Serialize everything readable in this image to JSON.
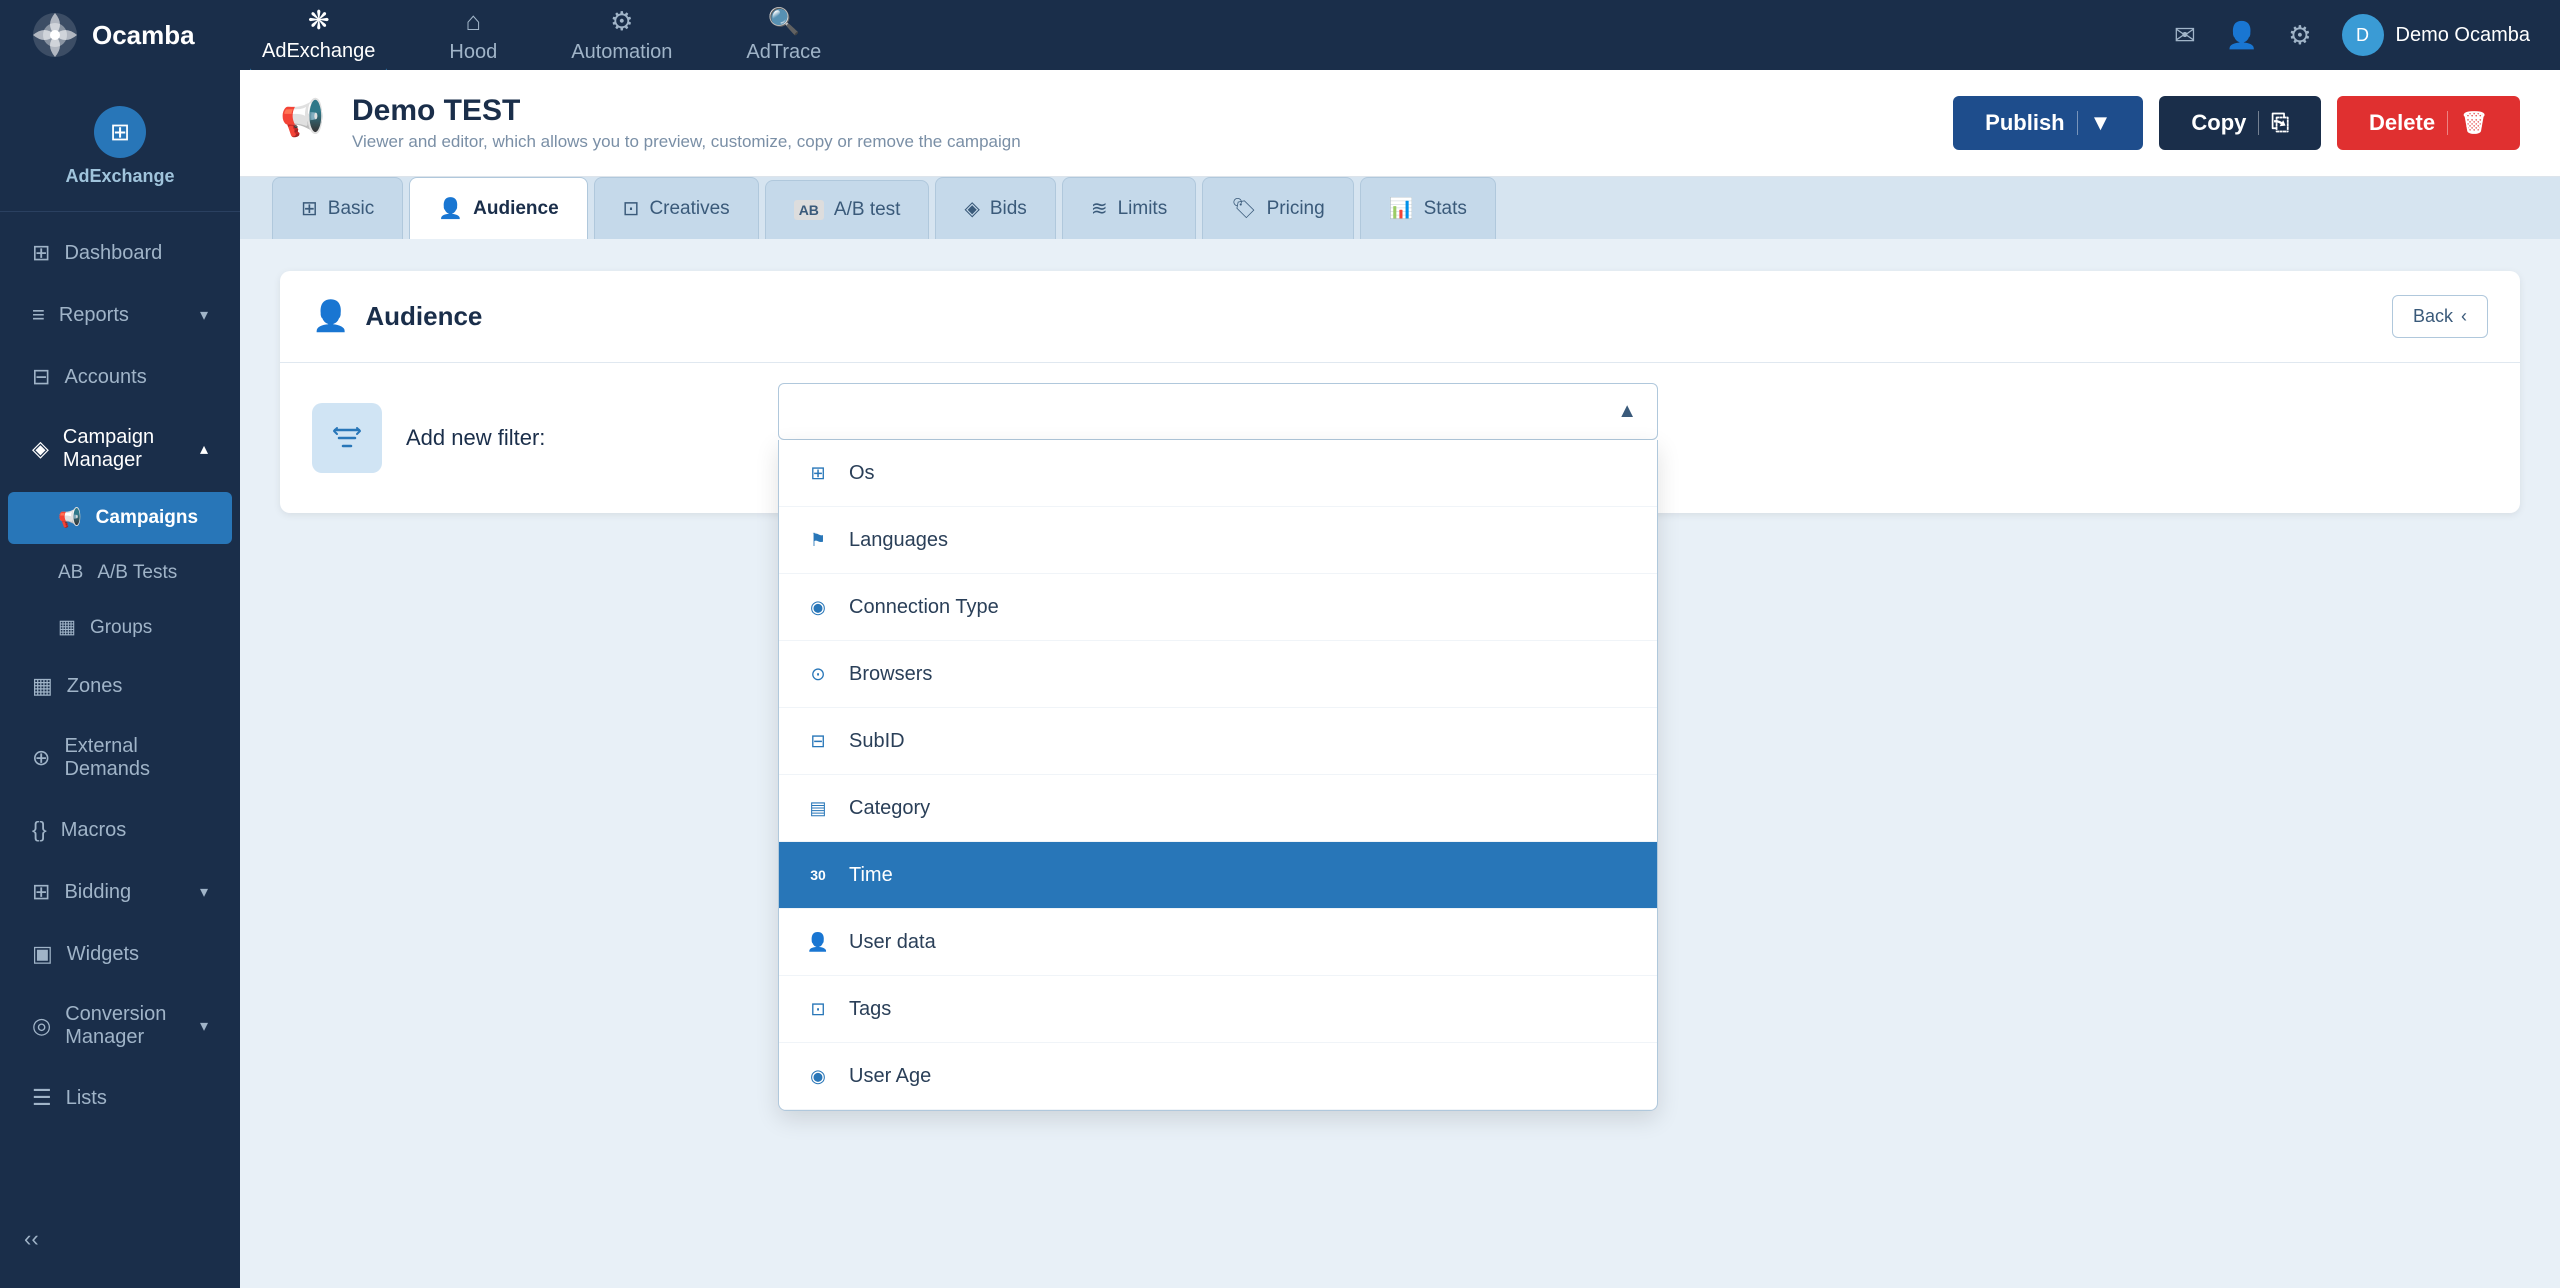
{
  "app": {
    "name": "Ocamba"
  },
  "top_nav": {
    "items": [
      {
        "id": "adexchange",
        "label": "AdExchange",
        "icon": "❋",
        "active": true
      },
      {
        "id": "hood",
        "label": "Hood",
        "icon": "⌂"
      },
      {
        "id": "automation",
        "label": "Automation",
        "icon": "⚙"
      },
      {
        "id": "adtrace",
        "label": "AdTrace",
        "icon": "🔍"
      }
    ],
    "user_name": "Demo Ocamba"
  },
  "sidebar": {
    "section": "AdExchange",
    "items": [
      {
        "id": "dashboard",
        "label": "Dashboard",
        "icon": "⊞",
        "expandable": false
      },
      {
        "id": "reports",
        "label": "Reports",
        "icon": "≡",
        "expandable": true
      },
      {
        "id": "accounts",
        "label": "Accounts",
        "icon": "⊟",
        "expandable": false
      },
      {
        "id": "campaign-manager",
        "label": "Campaign Manager",
        "icon": "◈",
        "expandable": true,
        "active": true
      },
      {
        "id": "campaigns",
        "label": "Campaigns",
        "sub": true,
        "active": true
      },
      {
        "id": "ab-tests",
        "label": "A/B Tests",
        "sub": true
      },
      {
        "id": "groups",
        "label": "Groups",
        "sub": true
      },
      {
        "id": "zones",
        "label": "Zones",
        "icon": "▦",
        "expandable": false
      },
      {
        "id": "external-demands",
        "label": "External Demands",
        "icon": "⊕",
        "expandable": false
      },
      {
        "id": "macros",
        "label": "Macros",
        "icon": "{}",
        "expandable": false
      },
      {
        "id": "bidding",
        "label": "Bidding",
        "icon": "⊞",
        "expandable": true
      },
      {
        "id": "widgets",
        "label": "Widgets",
        "icon": "▣",
        "expandable": false
      },
      {
        "id": "conversion-manager",
        "label": "Conversion Manager",
        "icon": "◎",
        "expandable": true
      },
      {
        "id": "lists",
        "label": "Lists",
        "icon": "☰",
        "expandable": false
      }
    ]
  },
  "page": {
    "title": "Demo TEST",
    "subtitle": "Viewer and editor, which allows you to preview, customize, copy or remove the campaign"
  },
  "actions": {
    "publish_label": "Publish",
    "copy_label": "Copy",
    "delete_label": "Delete"
  },
  "tabs": [
    {
      "id": "basic",
      "label": "Basic",
      "icon": "⊞"
    },
    {
      "id": "audience",
      "label": "Audience",
      "icon": "👤",
      "active": true
    },
    {
      "id": "creatives",
      "label": "Creatives",
      "icon": "⊡"
    },
    {
      "id": "ab-test",
      "label": "A/B test",
      "icon": "AB"
    },
    {
      "id": "bids",
      "label": "Bids",
      "icon": "◈"
    },
    {
      "id": "limits",
      "label": "Limits",
      "icon": "≋"
    },
    {
      "id": "pricing",
      "label": "Pricing",
      "icon": "🏷"
    },
    {
      "id": "stats",
      "label": "Stats",
      "icon": "📊"
    }
  ],
  "audience": {
    "title": "Audience",
    "back_label": "Back",
    "filter_label": "Add new filter:",
    "dropdown": {
      "items": [
        {
          "id": "os",
          "label": "Os",
          "icon": "⊞"
        },
        {
          "id": "languages",
          "label": "Languages",
          "icon": "⚑"
        },
        {
          "id": "connection-type",
          "label": "Connection Type",
          "icon": "◉"
        },
        {
          "id": "browsers",
          "label": "Browsers",
          "icon": "⊙"
        },
        {
          "id": "subid",
          "label": "SubID",
          "icon": "⊟"
        },
        {
          "id": "category",
          "label": "Category",
          "icon": "▤"
        },
        {
          "id": "time",
          "label": "Time",
          "icon": "30",
          "selected": true
        },
        {
          "id": "user-data",
          "label": "User data",
          "icon": "👤"
        },
        {
          "id": "tags",
          "label": "Tags",
          "icon": "⊡"
        },
        {
          "id": "user-age",
          "label": "User Age",
          "icon": "◉"
        }
      ]
    }
  }
}
